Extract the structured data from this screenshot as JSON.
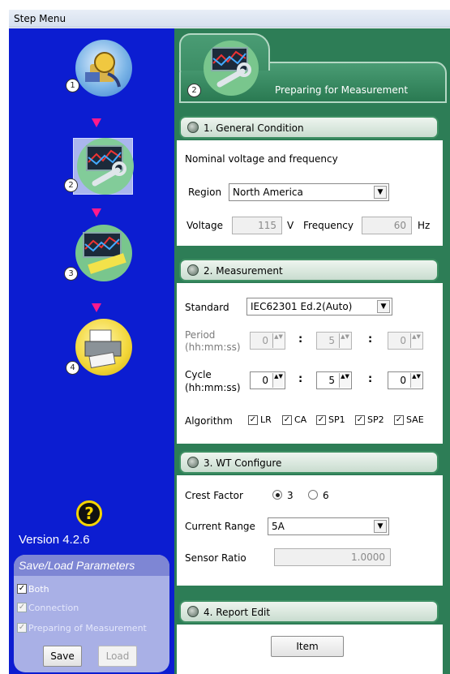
{
  "window": {
    "title": "Step Menu"
  },
  "steps": [
    {
      "number": "1",
      "icon": "connection-icon",
      "arrow_color": "#ff1a8c"
    },
    {
      "number": "2",
      "icon": "measurement-setup-icon",
      "selected": true
    },
    {
      "number": "3",
      "icon": "ruler-chart-icon"
    },
    {
      "number": "4",
      "icon": "printer-icon"
    }
  ],
  "sidebar": {
    "version": "Version 4.2.6",
    "help_icon": "?",
    "save_load": {
      "title": "Save/Load Parameters",
      "options": [
        {
          "label": "Both",
          "checked": true,
          "enabled": true
        },
        {
          "label": "Connection",
          "checked": true,
          "enabled": false
        },
        {
          "label": "Preparing of Measurement",
          "checked": true,
          "enabled": false
        }
      ],
      "save_label": "Save",
      "load_label": "Load"
    }
  },
  "tab": {
    "number": "2",
    "label": "Preparing for Measurement"
  },
  "general": {
    "header": "1. General Condition",
    "description": "Nominal voltage and frequency",
    "region_label": "Region",
    "region_value": "North America",
    "voltage_label": "Voltage",
    "voltage_value": "115",
    "voltage_unit": "V",
    "frequency_label": "Frequency",
    "frequency_value": "60",
    "frequency_unit": "Hz"
  },
  "measurement": {
    "header": "2. Measurement",
    "standard_label": "Standard",
    "standard_value": "IEC62301 Ed.2(Auto)",
    "period_label_1": "Period",
    "period_label_2": "(hh:mm:ss)",
    "period": {
      "hh": "0",
      "mm": "5",
      "ss": "0"
    },
    "cycle_label_1": "Cycle",
    "cycle_label_2": "(hh:mm:ss)",
    "cycle": {
      "hh": "0",
      "mm": "5",
      "ss": "0"
    },
    "colon": ":",
    "algorithm_label": "Algorithm",
    "algorithms": [
      {
        "label": "LR",
        "checked": true
      },
      {
        "label": "CA",
        "checked": true
      },
      {
        "label": "SP1",
        "checked": true
      },
      {
        "label": "SP2",
        "checked": true
      },
      {
        "label": "SAE",
        "checked": true
      }
    ]
  },
  "wt": {
    "header": "3. WT Configure",
    "crest_label": "Crest Factor",
    "crest_options": [
      {
        "label": "3",
        "selected": true
      },
      {
        "label": "6",
        "selected": false
      }
    ],
    "current_range_label": "Current Range",
    "current_range_value": "5A",
    "sensor_ratio_label": "Sensor Ratio",
    "sensor_ratio_value": "1.0000"
  },
  "report": {
    "header": "4. Report Edit",
    "item_label": "Item"
  },
  "checkmark": "✓",
  "dropdown_arrow": "▼",
  "spin_glyphs": "▲▼"
}
